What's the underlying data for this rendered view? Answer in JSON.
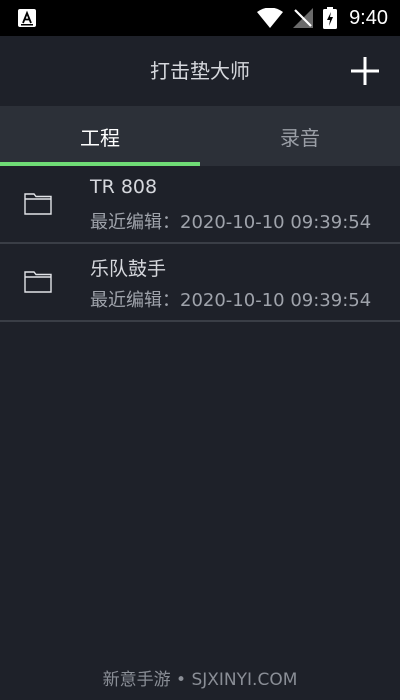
{
  "status_bar": {
    "time": "9:40",
    "left_icon": "accessibility-a-icon",
    "icons": [
      "wifi-icon",
      "no-signal-icon",
      "battery-charging-icon"
    ]
  },
  "app_bar": {
    "title": "打击垫大师",
    "add_icon": "plus-icon"
  },
  "tabs": [
    {
      "label": "工程",
      "active": true
    },
    {
      "label": "录音",
      "active": false
    }
  ],
  "accent_color": "#6fdc76",
  "projects": [
    {
      "name": "TR 808",
      "meta": "最近编辑：2020-10-10 09:39:54",
      "icon": "folder-icon"
    },
    {
      "name": "乐队鼓手",
      "meta": "最近编辑：2020-10-10 09:39:54",
      "icon": "folder-icon"
    }
  ],
  "watermark": "新意手游 • SJXINYI.COM"
}
